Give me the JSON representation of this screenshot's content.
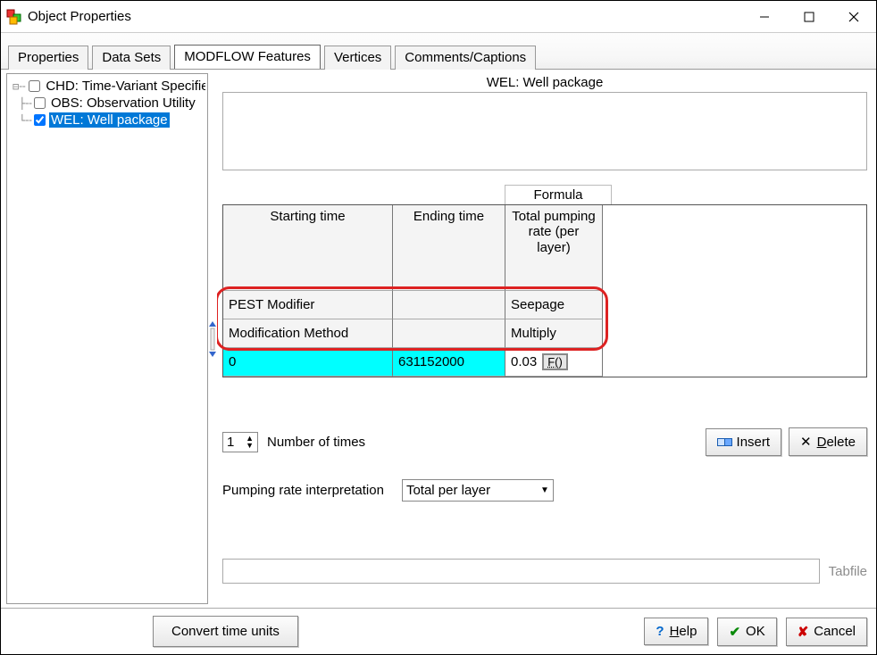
{
  "window": {
    "title": "Object Properties"
  },
  "tabs": {
    "items": [
      {
        "label": "Properties",
        "active": false
      },
      {
        "label": "Data Sets",
        "active": false
      },
      {
        "label": "MODFLOW Features",
        "active": true
      },
      {
        "label": "Vertices",
        "active": false
      },
      {
        "label": "Comments/Captions",
        "active": false
      }
    ]
  },
  "tree": {
    "items": [
      {
        "label": "CHD: Time-Variant Specified-Head",
        "checked": false,
        "selected": false
      },
      {
        "label": "OBS: Observation Utility",
        "checked": false,
        "selected": false
      },
      {
        "label": "WEL: Well package",
        "checked": true,
        "selected": true
      }
    ]
  },
  "panel": {
    "title": "WEL: Well package",
    "formula_label": "Formula",
    "columns": {
      "a": "Starting time",
      "b": "Ending time",
      "c": "Total pumping rate (per layer)"
    },
    "rows": {
      "pest_modifier": {
        "label": "PEST Modifier",
        "b": "",
        "c": "Seepage"
      },
      "mod_method": {
        "label": "Modification Method",
        "b": "",
        "c": "Multiply"
      },
      "data": {
        "a": "0",
        "b": "631152000",
        "c": "0.03",
        "fx": "F()"
      }
    },
    "num_times": {
      "value": "1",
      "label": "Number of times"
    },
    "insert_label": "Insert",
    "delete_label_pre": "D",
    "delete_label_post": "elete",
    "pumping_rate_label": "Pumping rate interpretation",
    "pumping_rate_selected": "Total per layer",
    "tabfile_label": "Tabfile"
  },
  "bottom": {
    "convert_label": "Convert time units",
    "help_pre": "H",
    "help_post": "elp",
    "ok_label": "OK",
    "cancel_label": "Cancel"
  }
}
